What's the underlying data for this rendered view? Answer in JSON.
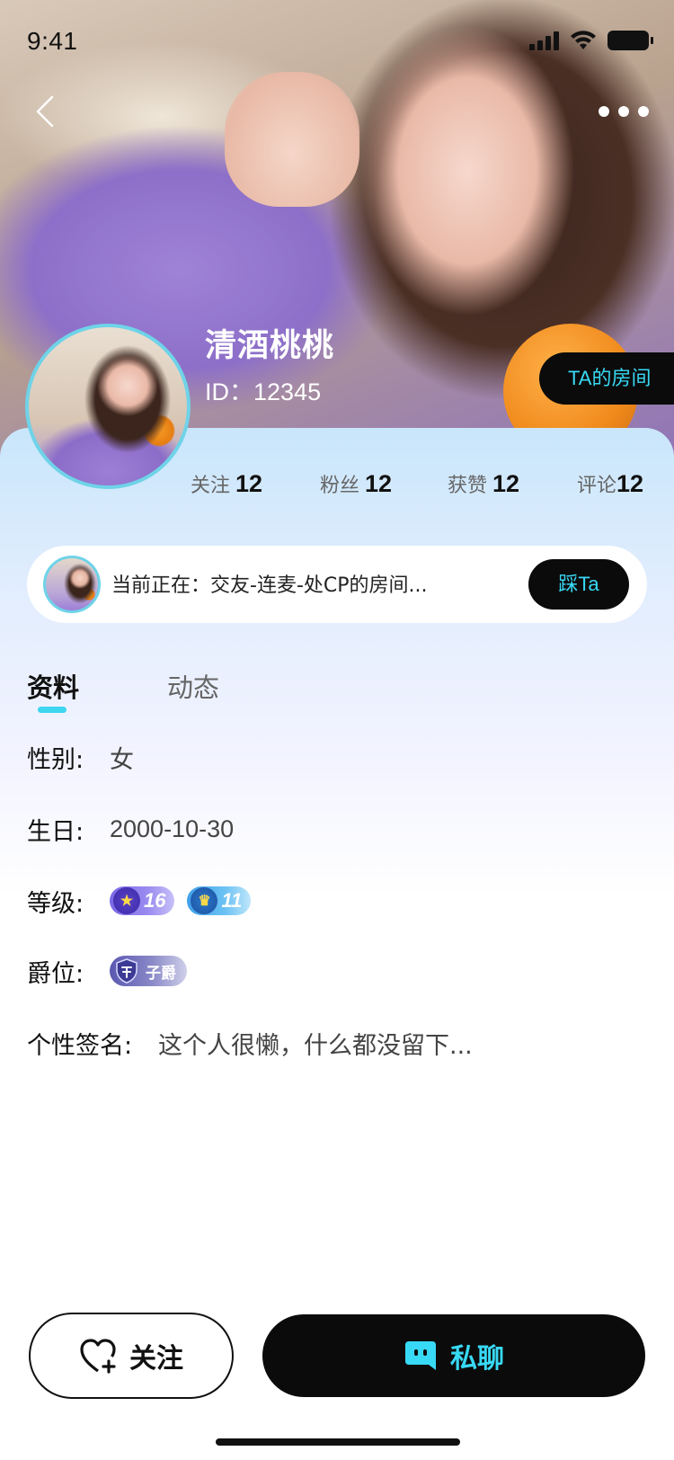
{
  "status_bar": {
    "time": "9:41",
    "icons": [
      "signal-icon",
      "wifi-icon",
      "battery-icon"
    ]
  },
  "nav": {
    "back_icon": "chevron-left-icon",
    "more_icon": "more-dots-icon"
  },
  "profile": {
    "name": "清酒桃桃",
    "id": "ID：12345",
    "room_button": "TA的房间"
  },
  "stats": [
    {
      "label": "关注",
      "value": "12"
    },
    {
      "label": "粉丝",
      "value": "12"
    },
    {
      "label": "获赞",
      "value": "12"
    },
    {
      "label": "评论",
      "value": "12"
    }
  ],
  "live": {
    "text": "当前正在：交友-连麦-处CP的房间...",
    "button": "踩Ta"
  },
  "tabs": [
    {
      "label": "资料",
      "active": true
    },
    {
      "label": "动态",
      "active": false
    }
  ],
  "info": {
    "gender_label": "性别:",
    "gender_value": "女",
    "birthday_label": "生日:",
    "birthday_value": "2000-10-30",
    "level_label": "等级:",
    "levels": [
      "16",
      "11"
    ],
    "rank_label": "爵位:",
    "rank_value": "子爵",
    "signature_label": "个性签名:",
    "signature_value": "这个人很懒，什么都没留下..."
  },
  "actions": {
    "follow": "关注",
    "chat": "私聊"
  },
  "colors": {
    "accent": "#38d9f5",
    "dark": "#0b0b0b",
    "avatar_ring": "#6fd3e8"
  }
}
